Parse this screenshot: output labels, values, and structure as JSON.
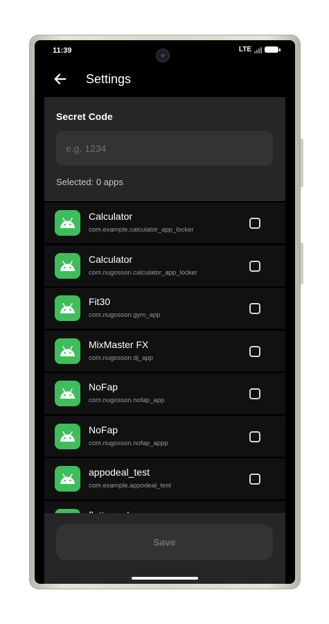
{
  "status_bar": {
    "time": "11:39",
    "network": "LTE"
  },
  "header": {
    "title": "Settings",
    "back_icon": "arrow-left-icon"
  },
  "secret_code": {
    "label": "Secret Code",
    "placeholder": "e.g. 1234",
    "value": "",
    "selected_text": "Selected: 0 apps"
  },
  "apps": [
    {
      "name": "Calculator",
      "package": "com.example.calculator_app_locker",
      "checked": false
    },
    {
      "name": "Calculator",
      "package": "com.nugosson.calculator_app_locker",
      "checked": false
    },
    {
      "name": "Fit30",
      "package": "com.nugosson.gym_app",
      "checked": false
    },
    {
      "name": "MixMaster FX",
      "package": "com.nugosson.dj_app",
      "checked": false
    },
    {
      "name": "NoFap",
      "package": "com.nugosson.nofap_app",
      "checked": false
    },
    {
      "name": "NoFap",
      "package": "com.nugosson.nofap_appp",
      "checked": false
    },
    {
      "name": "appodeal_test",
      "package": "com.example.appodeal_test",
      "checked": false
    },
    {
      "name": "flutter_ad",
      "package": "",
      "checked": false
    }
  ],
  "footer": {
    "save_label": "Save"
  },
  "colors": {
    "background": "#000000",
    "panel": "#262626",
    "row": "#111111",
    "app_icon": "#3dbe5a"
  }
}
